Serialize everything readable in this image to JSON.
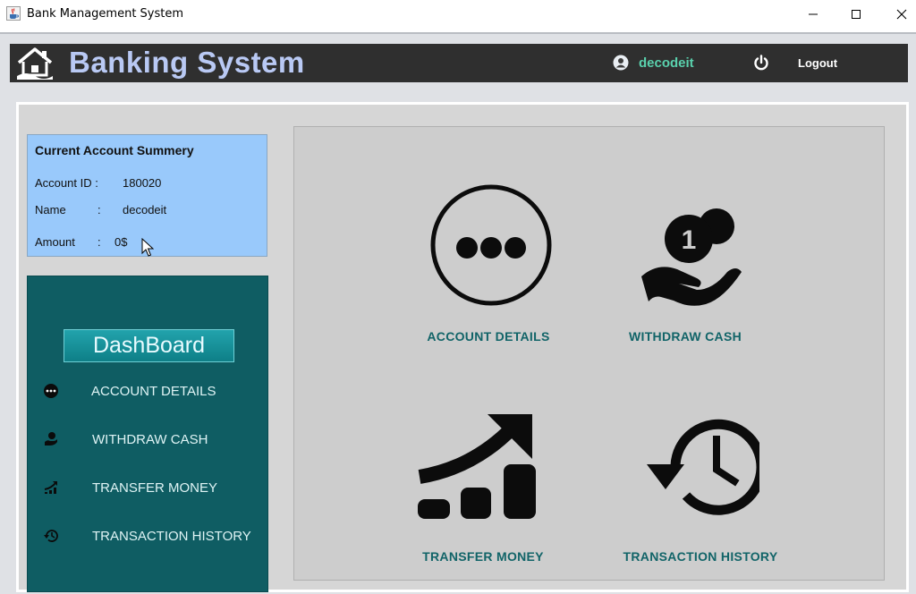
{
  "window": {
    "title": "Bank Management System",
    "icon": "java-cup-icon",
    "controls": [
      "minimize",
      "maximize",
      "close"
    ]
  },
  "header": {
    "title": "Banking System",
    "username": "decodeit",
    "logout_label": "Logout"
  },
  "summary": {
    "title": "Current Account Summery",
    "account_id_label": "Account ID :",
    "account_id_value": "180020",
    "name_label": "Name",
    "name_sep": ":",
    "name_value": "decodeit",
    "amount_label": "Amount",
    "amount_sep": ":",
    "amount_value": "0$"
  },
  "sidebar": {
    "dashboard_label": "DashBoard",
    "items": [
      {
        "label": "ACCOUNT DETAILS",
        "icon": "more-dots-icon"
      },
      {
        "label": "WITHDRAW CASH",
        "icon": "hand-coin-icon"
      },
      {
        "label": "TRANSFER MONEY",
        "icon": "growth-chart-icon"
      },
      {
        "label": "TRANSACTION HISTORY",
        "icon": "history-clock-icon"
      }
    ]
  },
  "tiles": [
    {
      "label": "ACCOUNT DETAILS",
      "icon": "more-dots-icon"
    },
    {
      "label": "WITHDRAW CASH",
      "icon": "hand-coin-icon"
    },
    {
      "label": "TRANSFER MONEY",
      "icon": "growth-chart-icon"
    },
    {
      "label": "TRANSACTION HISTORY",
      "icon": "history-clock-icon"
    }
  ],
  "colors": {
    "header_bg": "#2f2f2f",
    "header_title": "#b9c9f4",
    "username": "#5ad1ad",
    "summary_bg": "#99c9fb",
    "sidebar_bg": "#0f5d63",
    "tile_label": "#116468",
    "content_bg": "#cdcdcd"
  }
}
